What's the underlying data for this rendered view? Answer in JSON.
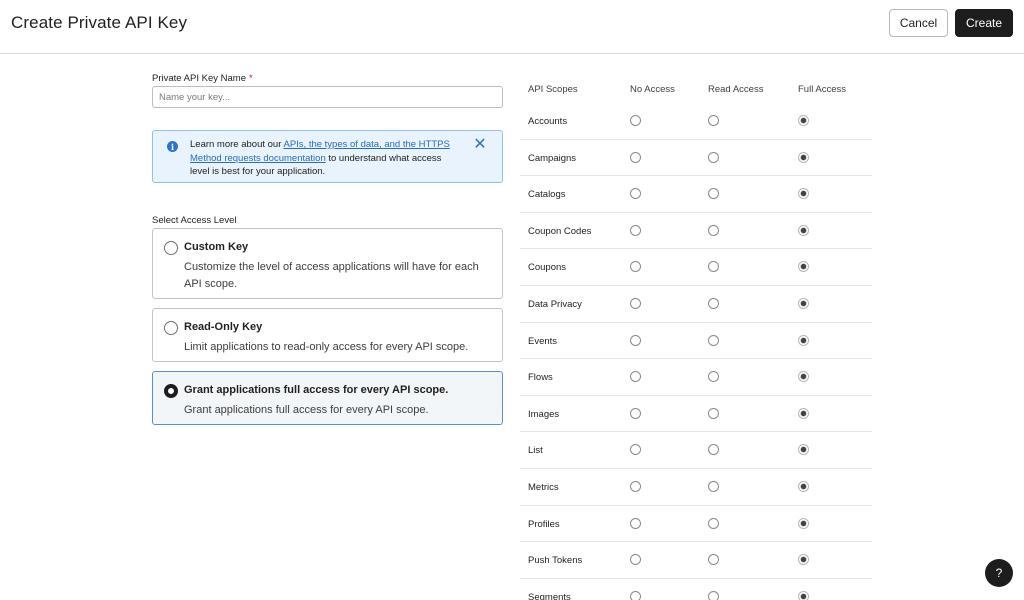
{
  "header": {
    "title": "Create Private API Key",
    "cancel_label": "Cancel",
    "create_label": "Create"
  },
  "key_name": {
    "label": "Private API Key Name",
    "required_mark": "*",
    "placeholder": "Name your key...",
    "value": ""
  },
  "info": {
    "text_before": "Learn more about our ",
    "link_text": "APIs, the types of data, and the HTTPS Method requests documentation",
    "text_after": " to understand what access level is best for your application.",
    "icon": "info-icon",
    "close_icon": "close-icon"
  },
  "access_level": {
    "label": "Select Access Level",
    "options": [
      {
        "title": "Custom Key",
        "description": "Customize the level of access applications will have for each API scope.",
        "selected": false
      },
      {
        "title": "Read-Only Key",
        "description": "Limit applications to read-only access for every API scope.",
        "selected": false
      },
      {
        "title": "Grant applications full access for every API scope.",
        "description": "Grant applications full access for every API scope.",
        "selected": true
      }
    ]
  },
  "scopes": {
    "headers": [
      "API Scopes",
      "No Access",
      "Read Access",
      "Full Access"
    ],
    "rows": [
      {
        "name": "Accounts",
        "level": "full"
      },
      {
        "name": "Campaigns",
        "level": "full"
      },
      {
        "name": "Catalogs",
        "level": "full"
      },
      {
        "name": "Coupon Codes",
        "level": "full"
      },
      {
        "name": "Coupons",
        "level": "full"
      },
      {
        "name": "Data Privacy",
        "level": "full"
      },
      {
        "name": "Events",
        "level": "full"
      },
      {
        "name": "Flows",
        "level": "full"
      },
      {
        "name": "Images",
        "level": "full"
      },
      {
        "name": "List",
        "level": "full"
      },
      {
        "name": "Metrics",
        "level": "full"
      },
      {
        "name": "Profiles",
        "level": "full"
      },
      {
        "name": "Push Tokens",
        "level": "full"
      },
      {
        "name": "Segments",
        "level": "full"
      }
    ]
  },
  "help": {
    "label": "?",
    "icon": "help-icon"
  },
  "colors": {
    "primary_button": "#1d1d1d",
    "info_bg": "#e8f3fd",
    "info_accent": "#2f74c0",
    "link": "#2a6cb8",
    "required": "#c8102e"
  }
}
